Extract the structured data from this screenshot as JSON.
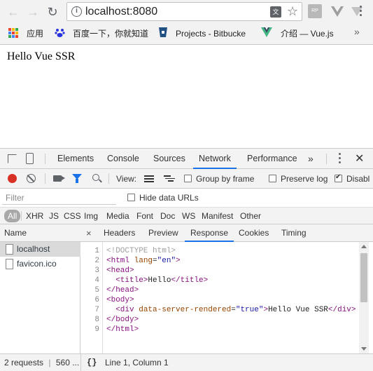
{
  "browser": {
    "url": "localhost:8080",
    "bookmarks": [
      {
        "label": "应用"
      },
      {
        "label": "百度一下，你就知道"
      },
      {
        "label": "Projects - Bitbucke"
      },
      {
        "label": "介绍 — Vue.js"
      }
    ],
    "more_label": "»",
    "rp_label": "RP"
  },
  "page": {
    "content": "Hello Vue SSR"
  },
  "devtools": {
    "tabs": [
      "Elements",
      "Console",
      "Sources",
      "Network",
      "Performance"
    ],
    "more_tabs": "»",
    "active_tab": "Network",
    "toolbar": {
      "view_label": "View:",
      "group_by_frame": "Group by frame",
      "preserve_log": "Preserve log",
      "disable_cache": "Disabl"
    },
    "filter": {
      "placeholder": "Filter",
      "hide_data_urls": "Hide data URLs"
    },
    "types": [
      "All",
      "XHR",
      "JS",
      "CSS",
      "Img",
      "Media",
      "Font",
      "Doc",
      "WS",
      "Manifest",
      "Other"
    ],
    "requests_header": "Name",
    "requests": [
      "localhost",
      "favicon.ico"
    ],
    "detail_close": "×",
    "detail_tabs": [
      "Headers",
      "Preview",
      "Response",
      "Cookies",
      "Timing"
    ],
    "active_detail_tab": "Response",
    "line_numbers": [
      "1",
      "2",
      "3",
      "4",
      "5",
      "6",
      "7",
      "8",
      "9"
    ],
    "status": {
      "requests": "2 requests",
      "size": "560 ...",
      "format": "{}",
      "position": "Line 1, Column 1"
    }
  },
  "colors": {
    "accent": "#1a73e8",
    "record": "#d93025"
  }
}
